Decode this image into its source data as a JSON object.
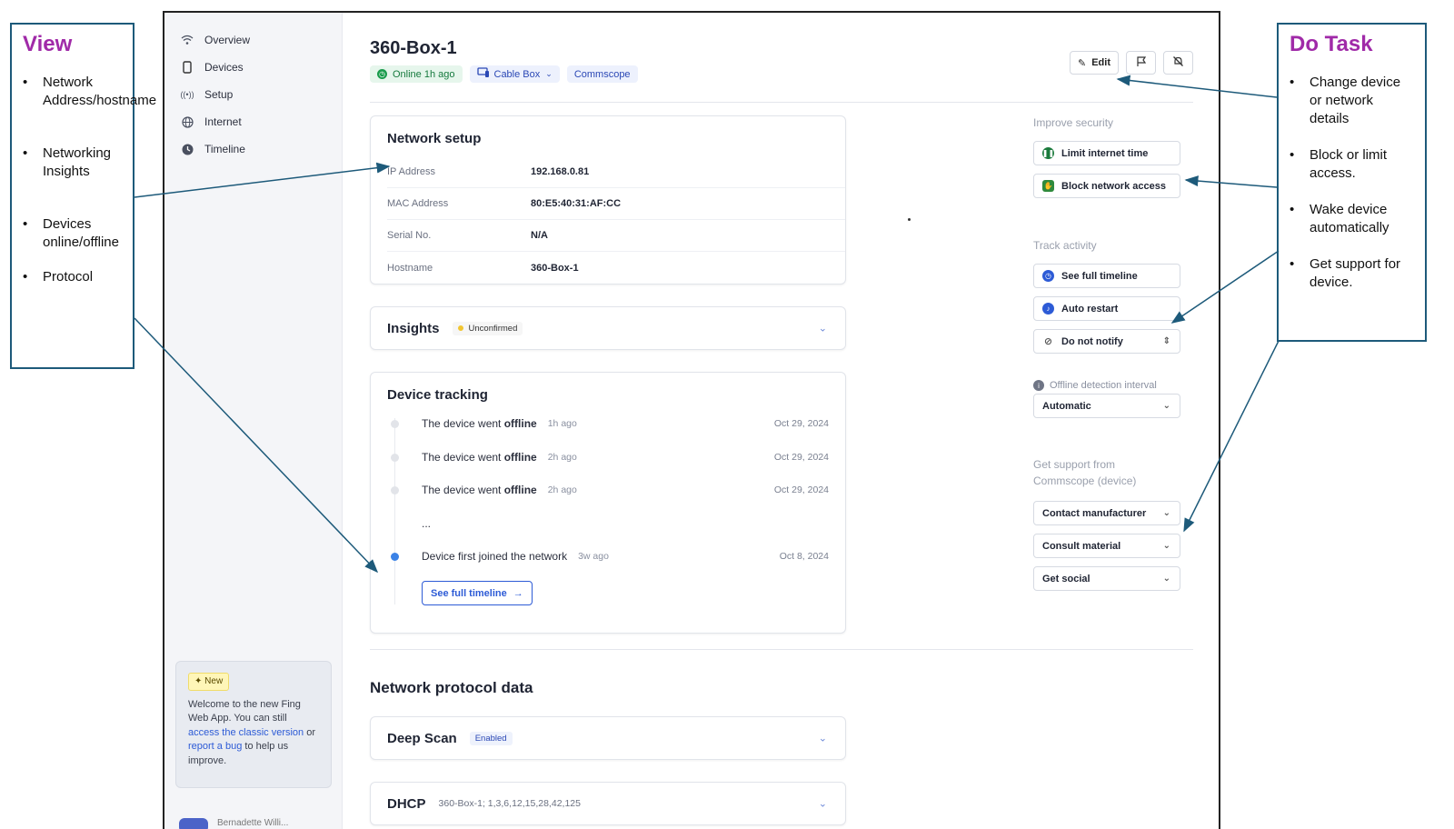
{
  "annotations": {
    "view": {
      "title": "View",
      "items": [
        "Network Address/hostname",
        "Networking Insights",
        "Devices online/offline",
        "Protocol"
      ]
    },
    "do_task": {
      "title": "Do Task",
      "items": [
        "Change device or network details",
        "Block or limit access.",
        "Wake device automatically",
        "Get support for device."
      ]
    },
    "arrow_color": "#1d5a7a",
    "title_color": "#a02aa8"
  },
  "sidebar": {
    "items": [
      {
        "label": "Overview",
        "icon": "wifi-icon"
      },
      {
        "label": "Devices",
        "icon": "phone-icon"
      },
      {
        "label": "Setup",
        "icon": "broadcast-icon"
      },
      {
        "label": "Internet",
        "icon": "globe-icon"
      },
      {
        "label": "Timeline",
        "icon": "clock-icon"
      }
    ],
    "new_card": {
      "badge": "New",
      "text_before": "Welcome to the new Fing Web App. You can still ",
      "link1": "access the classic version",
      "text_mid": " or ",
      "link2": "report a bug",
      "text_after": " to help us improve."
    },
    "user_name": "Bernadette Willi..."
  },
  "device": {
    "name": "360-Box-1",
    "status": "Online 1h ago",
    "type": "Cable Box",
    "brand": "Commscope"
  },
  "toolbar": {
    "edit_label": "Edit"
  },
  "network_setup": {
    "title": "Network setup",
    "rows": [
      {
        "key": "IP Address",
        "value": "192.168.0.81"
      },
      {
        "key": "MAC Address",
        "value": "80:E5:40:31:AF:CC"
      },
      {
        "key": "Serial No.",
        "value": "N/A"
      },
      {
        "key": "Hostname",
        "value": "360-Box-1"
      }
    ]
  },
  "insights": {
    "title": "Insights",
    "status": "Unconfirmed"
  },
  "tracking": {
    "title": "Device tracking",
    "events": [
      {
        "prefix": "The device went ",
        "bold": "offline",
        "ago": "1h ago",
        "date": "Oct 29, 2024"
      },
      {
        "prefix": "The device went ",
        "bold": "offline",
        "ago": "2h ago",
        "date": "Oct 29, 2024"
      },
      {
        "prefix": "The device went ",
        "bold": "offline",
        "ago": "2h ago",
        "date": "Oct 29, 2024"
      },
      {
        "prefix": "...",
        "bold": "",
        "ago": "",
        "date": ""
      },
      {
        "prefix": "Device first joined the network",
        "bold": "",
        "ago": "3w ago",
        "date": "Oct 8, 2024"
      }
    ],
    "see_full_label": "See full timeline"
  },
  "protocol": {
    "title": "Network protocol data",
    "deep_scan": {
      "title": "Deep Scan",
      "status": "Enabled"
    },
    "dhcp": {
      "title": "DHCP",
      "detail": "360-Box-1; 1,3,6,12,15,28,42,125"
    }
  },
  "right_panel": {
    "improve_security": "Improve security",
    "limit_label": "Limit internet time",
    "block_label": "Block network access",
    "track_activity": "Track activity",
    "timeline_label": "See full timeline",
    "restart_label": "Auto restart",
    "notify_label": "Do not notify",
    "offline_interval_label": "Offline detection interval",
    "offline_interval_value": "Automatic",
    "support_heading": "Get support from Commscope (device)",
    "contact_label": "Contact manufacturer",
    "consult_label": "Consult material",
    "social_label": "Get social"
  },
  "colors": {
    "online_green": "#1a9c4c",
    "link_blue": "#2d5bd6",
    "block_green": "#2f8a3c"
  }
}
